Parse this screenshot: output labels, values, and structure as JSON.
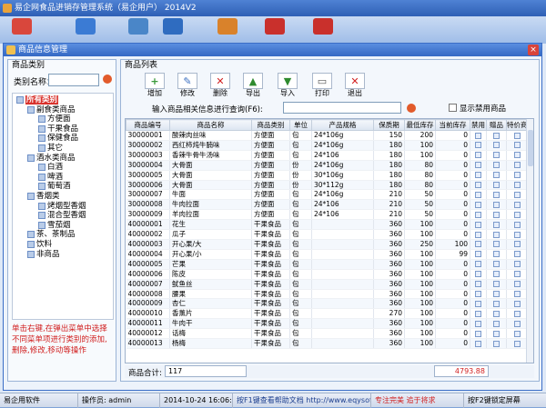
{
  "app": {
    "title": "易企网食品进销存管理系统（易企用户） 2014V2"
  },
  "toolbar": [
    {
      "label": "",
      "icon": "notebook-icon",
      "color": "#d9473c"
    },
    {
      "label": "",
      "icon": "users-icon",
      "color": "#3b7bd4"
    },
    {
      "label": "",
      "icon": "magnifier-icon",
      "color": "#4a86c8"
    },
    {
      "label": "",
      "icon": "group-icon",
      "color": "#2f6cc0"
    },
    {
      "label": "",
      "icon": "cash-register-icon",
      "color": "#d9822b"
    },
    {
      "label": "",
      "icon": "help-icon",
      "color": "#c9302c"
    },
    {
      "label": "",
      "icon": "power-icon",
      "color": "#c9302c"
    }
  ],
  "window": {
    "title": "商品信息管理",
    "close": "×"
  },
  "left": {
    "panel_title": "商品类别",
    "search_label": "类别名称：",
    "search_value": "",
    "tree": [
      {
        "label": "所有类别",
        "level": 0,
        "selected": true
      },
      {
        "label": "副食类商品",
        "level": 1
      },
      {
        "label": "方便面",
        "level": 2
      },
      {
        "label": "干果食品",
        "level": 2
      },
      {
        "label": "保健食品",
        "level": 2
      },
      {
        "label": "其它",
        "level": 2
      },
      {
        "label": "酒水类商品",
        "level": 1
      },
      {
        "label": "白酒",
        "level": 2
      },
      {
        "label": "啤酒",
        "level": 2
      },
      {
        "label": "葡萄酒",
        "level": 2
      },
      {
        "label": "香烟类",
        "level": 1
      },
      {
        "label": "烤烟型香烟",
        "level": 2
      },
      {
        "label": "混合型香烟",
        "level": 2
      },
      {
        "label": "雪茄烟",
        "level": 2
      },
      {
        "label": "茶、茶制品",
        "level": 1
      },
      {
        "label": "饮料",
        "level": 1
      },
      {
        "label": "非商品",
        "level": 1
      }
    ],
    "hint": "单击右键,在弹出菜单中选择不同菜单项进行类别的添加,删除,修改,移动等操作"
  },
  "right": {
    "panel_title": "商品列表",
    "actions": [
      {
        "label": "增加",
        "icon": "add-icon",
        "glyph": "+",
        "color": "#3a9a3a"
      },
      {
        "label": "修改",
        "icon": "edit-icon",
        "glyph": "✎",
        "color": "#3a6fc0"
      },
      {
        "label": "删除",
        "icon": "delete-icon",
        "glyph": "✕",
        "color": "#d12020"
      },
      {
        "label": "导出",
        "icon": "export-icon",
        "glyph": "▲",
        "color": "#2e8a2e"
      },
      {
        "label": "导入",
        "icon": "import-icon",
        "glyph": "▼",
        "color": "#2e8a2e"
      },
      {
        "label": "打印",
        "icon": "print-icon",
        "glyph": "▭",
        "color": "#555555"
      },
      {
        "label": "退出",
        "icon": "exit-icon",
        "glyph": "✕",
        "color": "#d12020"
      }
    ],
    "query_label": "输入商品相关信息进行查询(F6):",
    "query_value": "",
    "show_disabled_label": "显示禁用商品",
    "columns": [
      "商品编号",
      "商品名称",
      "商品类别",
      "单位",
      "产品规格",
      "保质期",
      "最低库存",
      "当前库存",
      "禁用",
      "赠品",
      "特价商品"
    ],
    "rows": [
      [
        "30000001",
        "酸辣肉丝味",
        "方便面",
        "包",
        "24*106g",
        "150",
        "200",
        "0"
      ],
      [
        "30000002",
        "西红柿炖牛腩味",
        "方便面",
        "包",
        "24*106g",
        "180",
        "100",
        "0"
      ],
      [
        "30000003",
        "香辣牛骨牛汤味",
        "方便面",
        "包",
        "24*106",
        "180",
        "100",
        "0"
      ],
      [
        "30000004",
        "大骨面",
        "方便面",
        "份",
        "24*106g",
        "180",
        "80",
        "0"
      ],
      [
        "30000005",
        "大骨面",
        "方便面",
        "份",
        "30*106g",
        "180",
        "80",
        "0"
      ],
      [
        "30000006",
        "大骨面",
        "方便面",
        "份",
        "30*112g",
        "180",
        "80",
        "0"
      ],
      [
        "30000007",
        "牛面",
        "方便面",
        "包",
        "24*106g",
        "210",
        "50",
        "0"
      ],
      [
        "30000008",
        "牛肉拉面",
        "方便面",
        "包",
        "24*106",
        "210",
        "50",
        "0"
      ],
      [
        "30000009",
        "羊肉拉面",
        "方便面",
        "包",
        "24*106",
        "210",
        "50",
        "0"
      ],
      [
        "40000001",
        "花生",
        "干果食品",
        "包",
        "",
        "360",
        "100",
        "0"
      ],
      [
        "40000002",
        "瓜子",
        "干果食品",
        "包",
        "",
        "360",
        "100",
        "0"
      ],
      [
        "40000003",
        "开心果/大",
        "干果食品",
        "包",
        "",
        "360",
        "250",
        "100"
      ],
      [
        "40000004",
        "开心果/小",
        "干果食品",
        "包",
        "",
        "360",
        "100",
        "99"
      ],
      [
        "40000005",
        "芒果",
        "干果食品",
        "包",
        "",
        "360",
        "100",
        "0"
      ],
      [
        "40000006",
        "陈皮",
        "干果食品",
        "包",
        "",
        "360",
        "100",
        "0"
      ],
      [
        "40000007",
        "鱿鱼丝",
        "干果食品",
        "包",
        "",
        "360",
        "100",
        "0"
      ],
      [
        "40000008",
        "腰果",
        "干果食品",
        "包",
        "",
        "360",
        "100",
        "0"
      ],
      [
        "40000009",
        "杏仁",
        "干果食品",
        "包",
        "",
        "360",
        "100",
        "0"
      ],
      [
        "40000010",
        "香薰片",
        "干果食品",
        "包",
        "",
        "270",
        "100",
        "0"
      ],
      [
        "40000011",
        "牛肉干",
        "干果食品",
        "包",
        "",
        "360",
        "100",
        "0"
      ],
      [
        "40000012",
        "话梅",
        "干果食品",
        "包",
        "",
        "360",
        "100",
        "0"
      ],
      [
        "40000013",
        "杨梅",
        "干果食品",
        "包",
        "",
        "360",
        "100",
        "0"
      ]
    ],
    "count_label": "商品合计:",
    "count_value": "117",
    "total_value": "4793.88"
  },
  "status": {
    "company": "易企用软件",
    "operator": "操作员: admin",
    "datetime": "2014-10-24 16:06:53",
    "help": "按F1键查看帮助文档 http://www.eqysoft.cn/",
    "slogan": "专注完美 追于将求",
    "lock": "按F2键锁定屏幕"
  },
  "colors": {
    "accent": "#3468c4",
    "highlight": "#d8312b",
    "hint": "#d12020"
  }
}
